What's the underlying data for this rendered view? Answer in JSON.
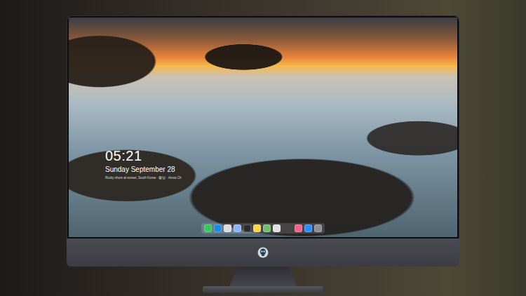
{
  "lock_screen": {
    "time": "05:21",
    "date": "Sunday September 28",
    "caption": "Rocky shore at sunset, South Korea · 촬영 · Amos Ch"
  },
  "dock": {
    "items": [
      {
        "color": "#34c759",
        "group": 1
      },
      {
        "color": "#1e88e5",
        "group": 1
      },
      {
        "color": "#d9dde3",
        "group": 1
      },
      {
        "color": "#8ab4f8",
        "group": 1
      },
      {
        "color": "#2b2b2b",
        "group": 1
      },
      {
        "color": "#f7d54a",
        "group": 1
      },
      {
        "color": "#6fbf73",
        "group": 1
      },
      {
        "color": "#e0e0e0",
        "group": 1
      },
      {
        "color": "#f06292",
        "group": 2
      },
      {
        "color": "#2f8cff",
        "group": 2
      },
      {
        "color": "#8e8e93",
        "group": 2
      }
    ]
  }
}
